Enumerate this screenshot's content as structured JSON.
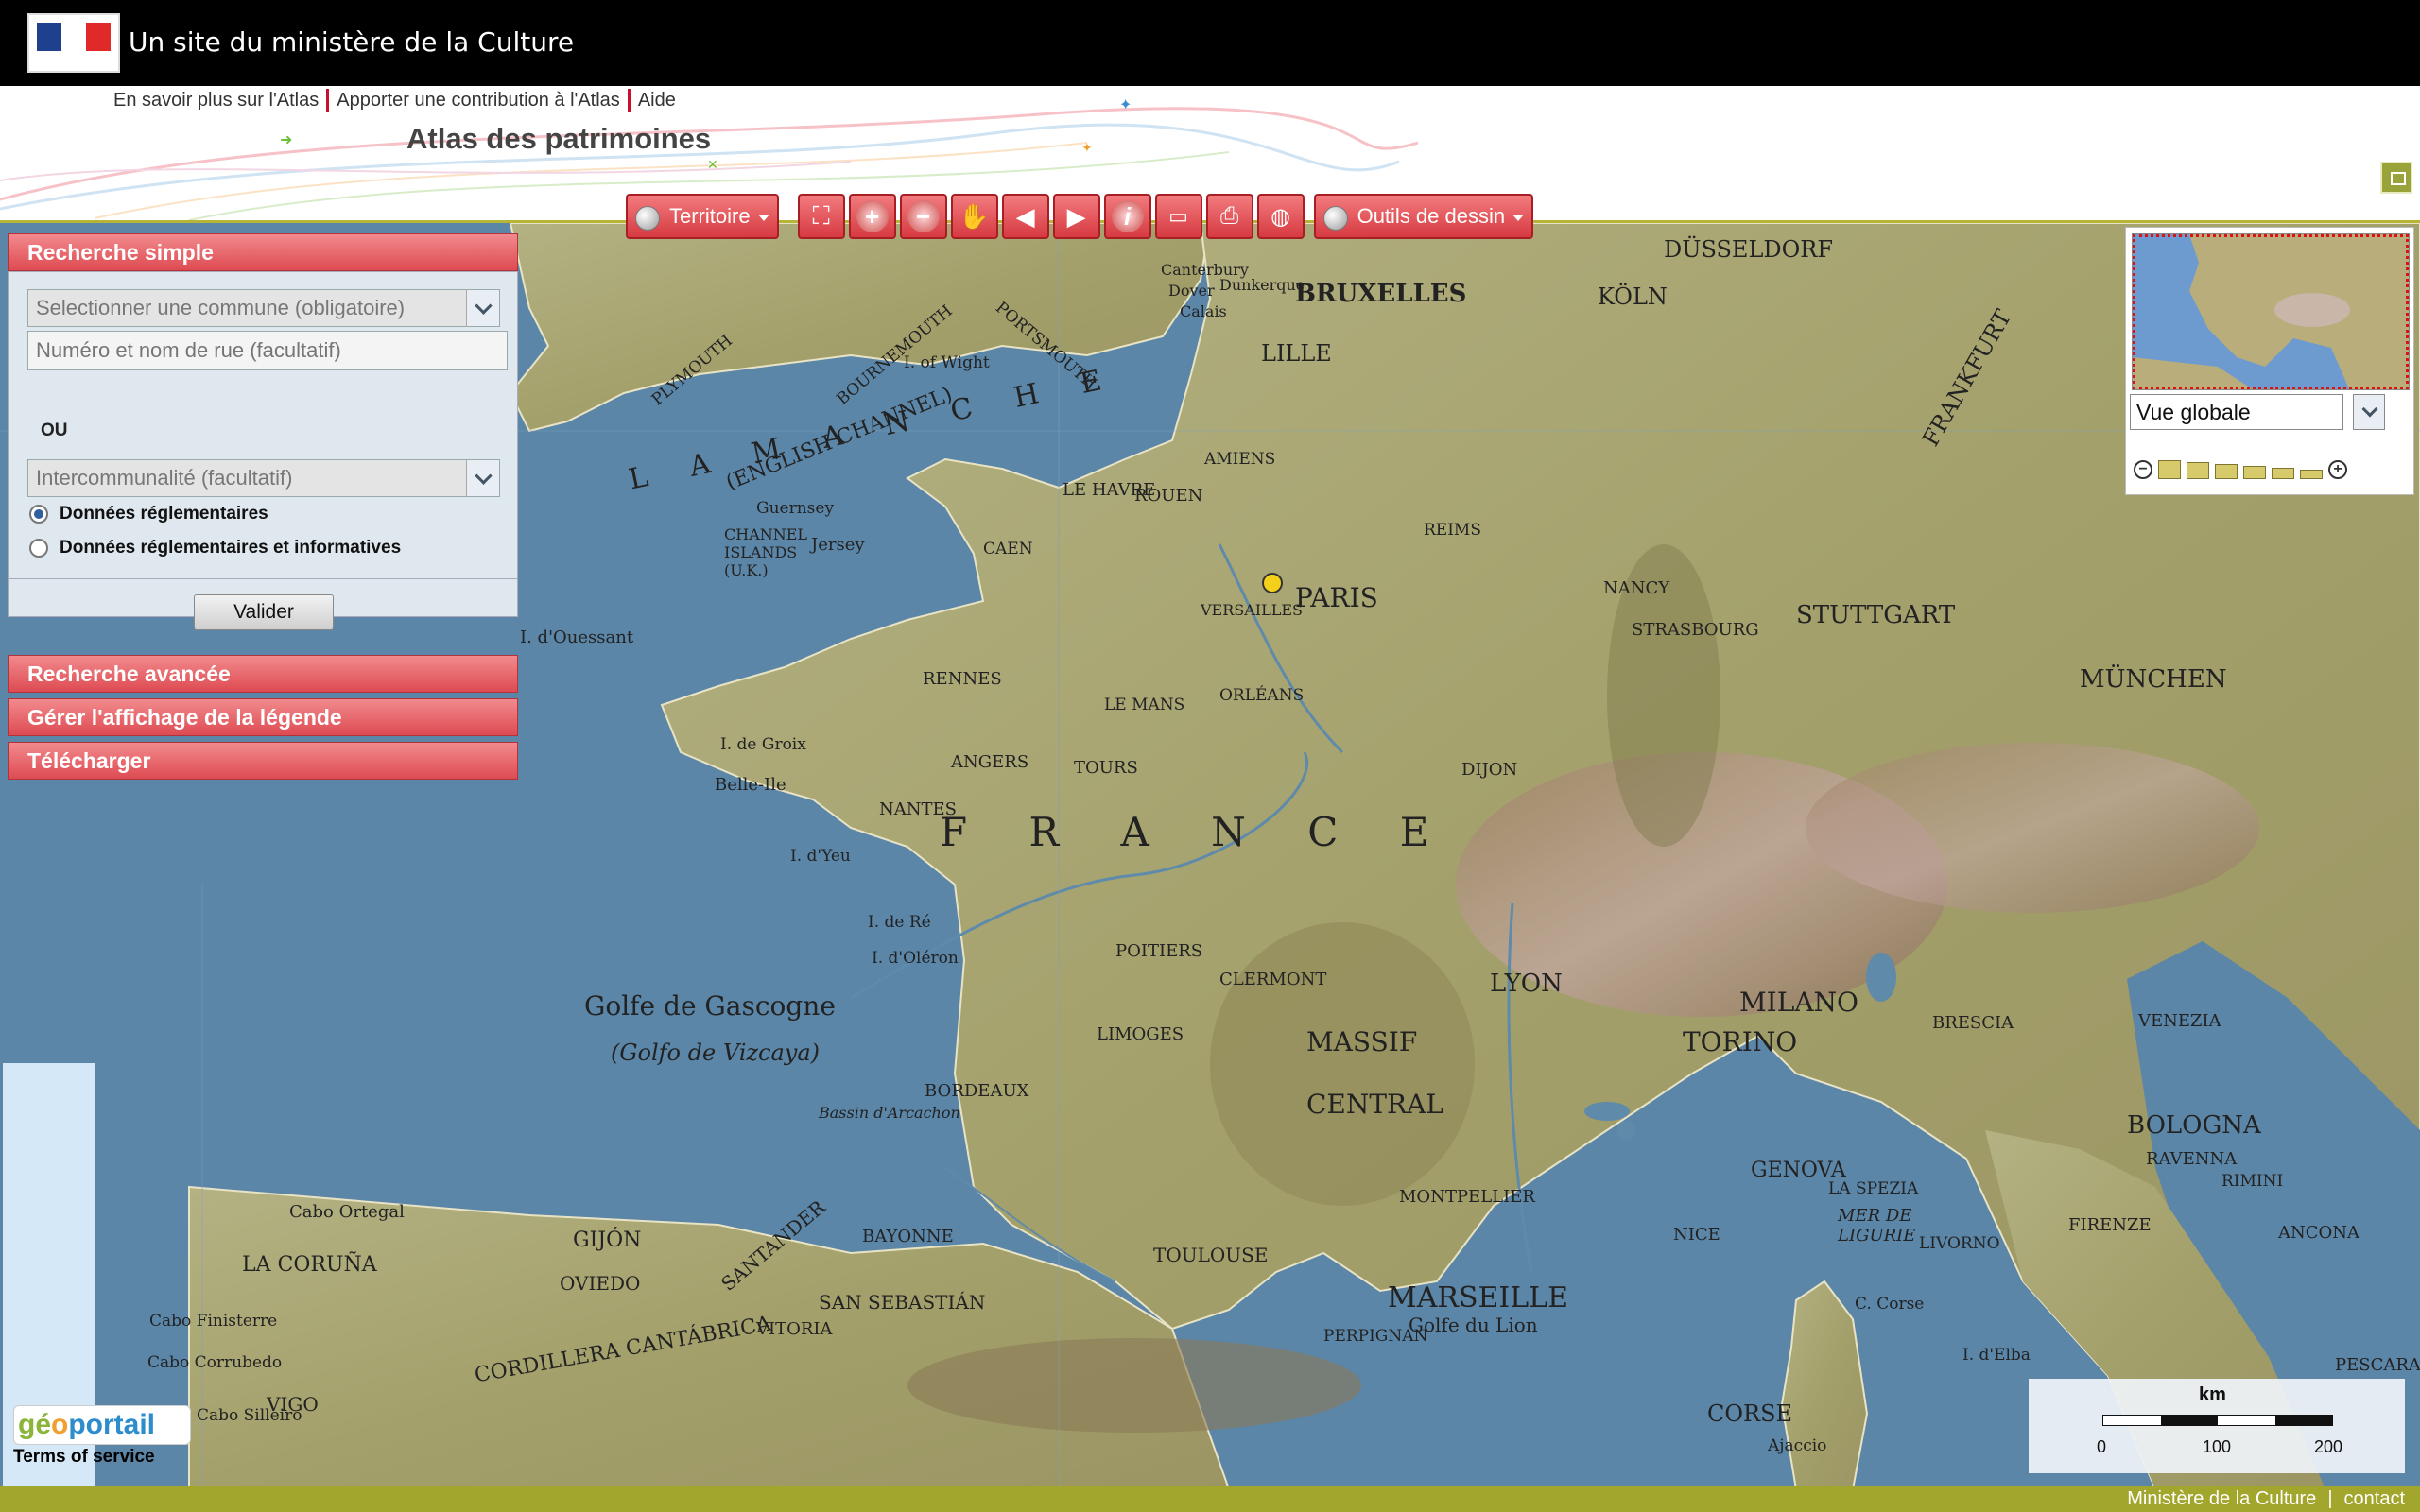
{
  "banner": {
    "site_label": "Un site du ministère de la Culture",
    "logo_name": "marianne-logo"
  },
  "header": {
    "links": [
      "En savoir plus sur l'Atlas",
      "Apporter une contribution à l'Atlas",
      "Aide"
    ],
    "title": "Atlas des patrimoines"
  },
  "toolbar": {
    "territoire_label": "Territoire",
    "drawing_label": "Outils de dessin",
    "tools": [
      "full-extent-icon",
      "zoom-in-icon",
      "zoom-out-icon",
      "pan-hand-icon",
      "previous-view-icon",
      "next-view-icon",
      "info-icon",
      "measure-icon",
      "print-icon",
      "layers-globe-icon"
    ]
  },
  "left_panel": {
    "simple_search": {
      "header": "Recherche simple",
      "commune_placeholder": "Selectionner une commune (obligatoire)",
      "street_placeholder": "Numéro et nom de rue (facultatif)",
      "or_label": "OU",
      "interco_placeholder": "Intercommunalité (facultatif)",
      "radio_1": "Données réglementaires",
      "radio_2": "Données réglementaires et informatives",
      "selected_radio": 1,
      "submit": "Valider"
    },
    "advanced_search": "Recherche avancée",
    "legend": "Gérer l'affichage de la légende",
    "download": "Télécharger"
  },
  "overview": {
    "view_select": "Vue globale"
  },
  "scale": {
    "unit": "km",
    "labels": [
      "0",
      "100",
      "200"
    ]
  },
  "map_labels": {
    "bruxelles": "BRUXELLES",
    "lille": "LILLE",
    "koln": "KÖLN",
    "dusseldorf": "DÜSSELDORF",
    "frankfurt": "FRANKFURT",
    "paris": "PARIS",
    "versailles": "VERSAILLES",
    "amiens": "AMIENS",
    "reims": "REIMS",
    "caen": "CAEN",
    "rouen": "ROUEN",
    "le_havre": "LE HAVRE",
    "rennes": "RENNES",
    "nantes": "NANTES",
    "angers": "ANGERS",
    "tours": "TOURS",
    "le_mans": "LE MANS",
    "orleans": "ORLÉANS",
    "dijon": "DIJON",
    "strasbourg": "STRASBOURG",
    "nancy": "NANCY",
    "stuttgart": "STUTTGART",
    "munchen": "MÜNCHEN",
    "poitiers": "POITIERS",
    "limoges": "LIMOGES",
    "clermont": "CLERMONT",
    "lyon": "LYON",
    "bordeaux": "BORDEAUX",
    "toulouse": "TOULOUSE",
    "montpellier": "MONTPELLIER",
    "marseille": "MARSEILLE",
    "golfe_du_lion": "Golfe du Lion",
    "nice": "NICE",
    "genova": "GENOVA",
    "torino": "TORINO",
    "milano": "MILANO",
    "brescia": "BRESCIA",
    "venezia": "VENEZIA",
    "bologna": "BOLOGNA",
    "ravenna": "RAVENNA",
    "firenze": "FIRENZE",
    "ancona": "ANCONA",
    "la_spezia": "LA SPEZIA",
    "livorno": "LIVORNO",
    "rimini": "RIMINI",
    "corse": "CORSE",
    "ajaccio": "Ajaccio",
    "perpignan": "PERPIGNAN",
    "bayonne": "BAYONNE",
    "la_coruna": "LA CORUÑA",
    "gijon": "GIJÓN",
    "oviedo": "OVIEDO",
    "santander": "SANTANDER",
    "vigo": "VIGO",
    "france": "F R A N C E",
    "massif": "MASSIF",
    "central": "CENTRAL",
    "manche": "L A   M A N C H E",
    "english_channel": "(ENGLISH CHANNEL)",
    "golfe_gascogne": "Golfe de Gascogne",
    "golfo_vizcaya": "(Golfo de Vizcaya)",
    "jersey": "Jersey",
    "guernsey": "Guernsey",
    "channel_islands": "CHANNEL\nISLANDS\n(U.K.)",
    "ouessant": "I. d'Ouessant",
    "belle_ile": "Belle-Ile",
    "ile_de_re": "I. de Ré",
    "ile_doleron": "I. d'Oléron",
    "ile_dyeu": "I. d'Yeu",
    "ile_de_groix": "I. de Groix",
    "plymouth": "PLYMOUTH",
    "bournemouth": "BOURNEMOUTH",
    "portsmouth": "PORTSMOUTH",
    "canterbury": "Canterbury",
    "dover": "Dover",
    "calais": "Calais",
    "dunkerque": "Dunkerque",
    "isle_of_wight": "I. of Wight",
    "bassin_arcachon": "Bassin d'Arcachon",
    "cabo_ortegal": "Cabo Ortegal",
    "cabo_finisterre": "Cabo Finisterre",
    "cabo_corrubedo": "Cabo Corrubedo",
    "cabo_silleiro": "Cabo Silleiro",
    "san_sebastian": "SAN SEBASTIÁN",
    "vitoria": "VITORIA",
    "cordillera": "CORDILLERA CANTÁBRICA",
    "mer_de_ligurie": "MER DE\nLIGURIE",
    "c_corse": "C. Corse",
    "ile_delba": "I. d'Elba",
    "pescara": "PESCARA"
  },
  "footer": {
    "ministry": "Ministère de la Culture",
    "separator": "|",
    "contact": "contact"
  },
  "colors": {
    "accent_red": "#de4b52",
    "footer_olive": "#a3a62c",
    "sea": "#5b86a8",
    "land": "#a7a874"
  }
}
